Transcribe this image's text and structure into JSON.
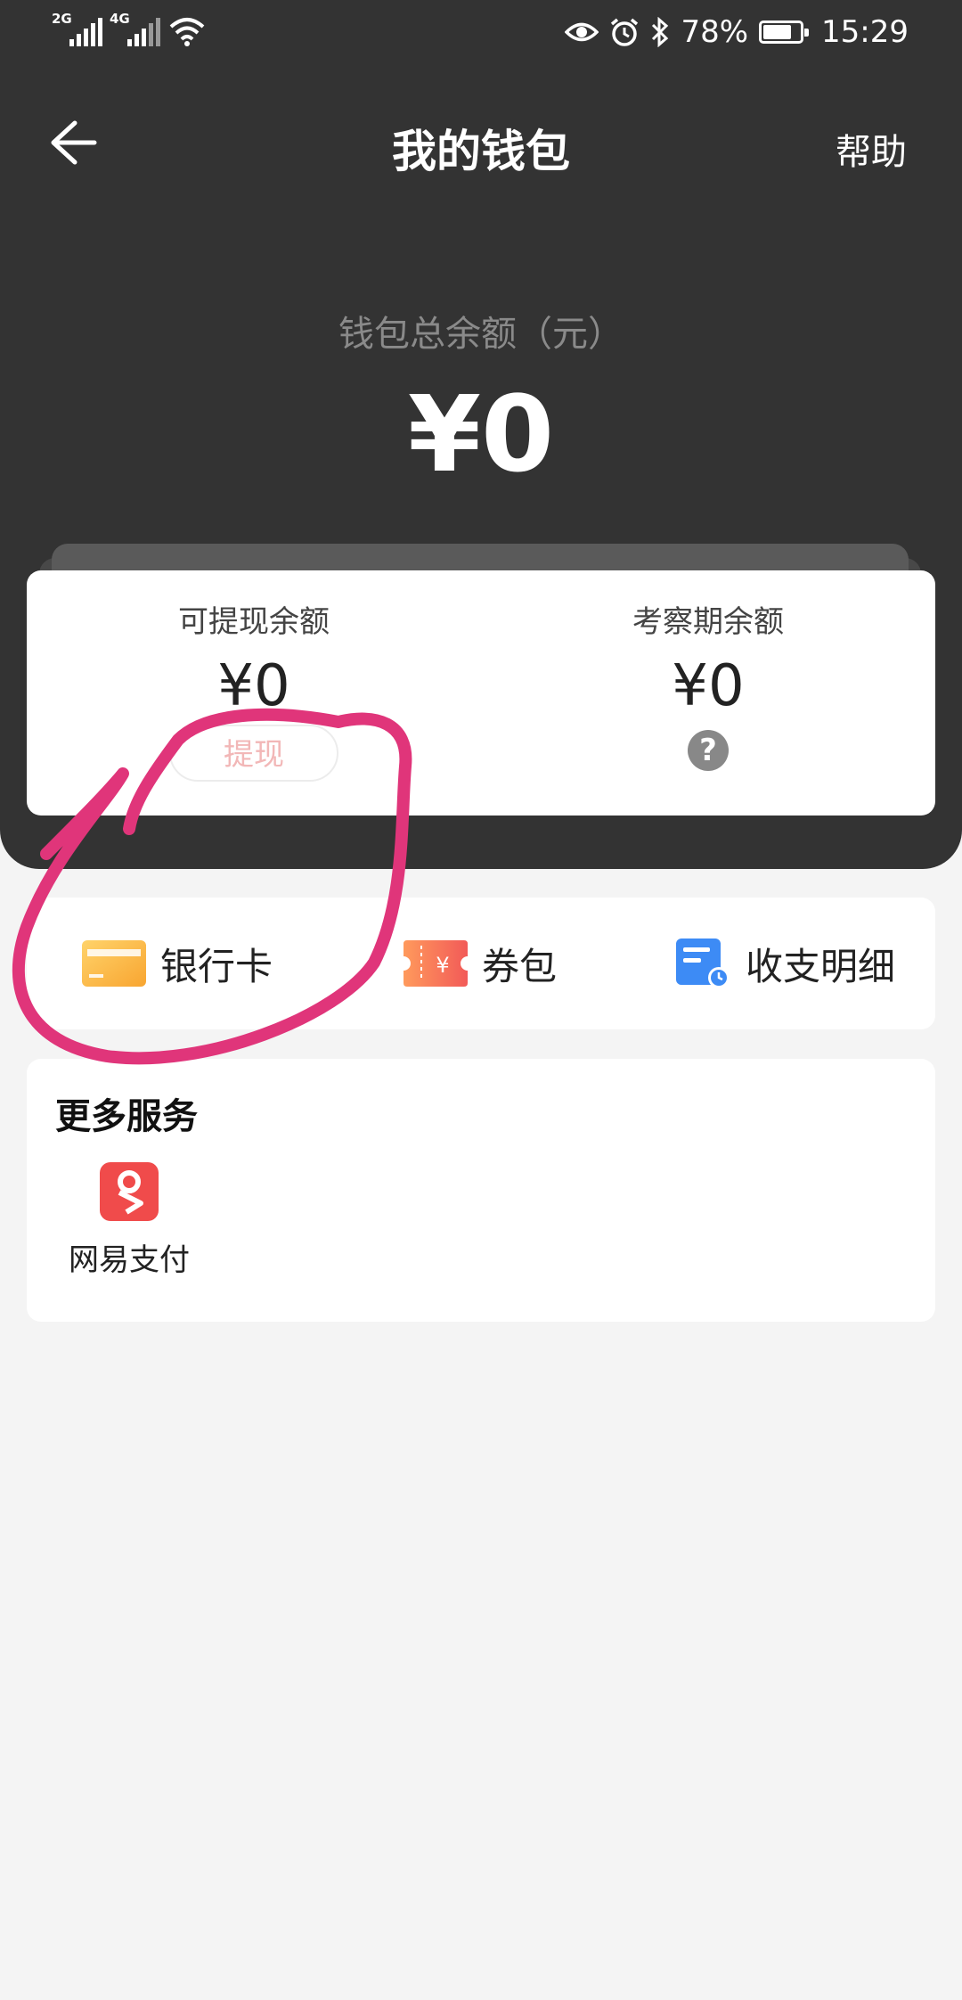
{
  "status_bar": {
    "signal1": "2G",
    "signal2": "4G",
    "battery_text": "78%",
    "battery_level": 0.78,
    "time": "15:29",
    "icons": [
      "wifi-icon",
      "eye-icon",
      "alarm-icon",
      "bluetooth-icon",
      "battery-icon"
    ]
  },
  "nav": {
    "title": "我的钱包",
    "help": "帮助",
    "back_icon": "back-arrow-icon"
  },
  "wallet": {
    "total_label": "钱包总余额（元）",
    "total_amount": "¥0",
    "withdrawable_label": "可提现余额",
    "withdrawable_amount": "¥0",
    "withdraw_button": "提现",
    "review_label": "考察期余额",
    "review_amount": "¥0",
    "review_help": "?"
  },
  "quick_actions": [
    {
      "label": "银行卡",
      "icon": "bank-card-icon"
    },
    {
      "label": "券包",
      "icon": "coupon-icon"
    },
    {
      "label": "收支明细",
      "icon": "bill-detail-icon"
    }
  ],
  "more_services": {
    "title": "更多服务",
    "items": [
      {
        "label": "网易支付",
        "icon": "netease-pay-icon"
      }
    ]
  },
  "colors": {
    "header_bg": "#333333",
    "annotation": "#e0357a",
    "withdraw_text": "#f2b7b7",
    "page_bg": "#f4f4f4"
  }
}
